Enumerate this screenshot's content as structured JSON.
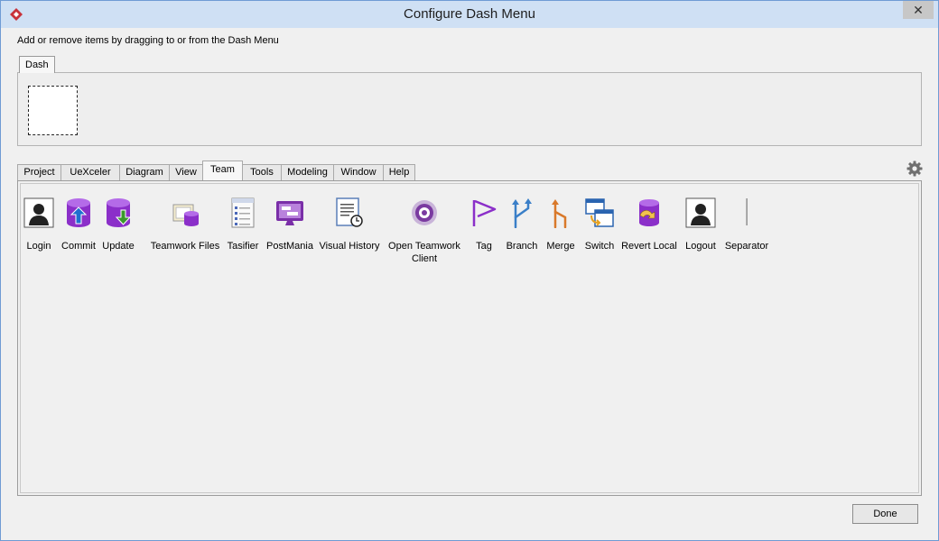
{
  "window": {
    "title": "Configure Dash Menu",
    "close_symbol": "✕"
  },
  "instruction": "Add or remove items by dragging to or from the Dash Menu",
  "dash_tab": "Dash",
  "tabs": [
    {
      "label": "Project"
    },
    {
      "label": "UeXceler"
    },
    {
      "label": "Diagram"
    },
    {
      "label": "View"
    },
    {
      "label": "Team",
      "active": true
    },
    {
      "label": "Tools"
    },
    {
      "label": "Modeling"
    },
    {
      "label": "Window"
    },
    {
      "label": "Help"
    }
  ],
  "items": [
    {
      "label": "Login",
      "icon": "user-silhouette-icon"
    },
    {
      "label": "Commit",
      "icon": "database-commit-icon"
    },
    {
      "label": "Update",
      "icon": "database-update-icon"
    },
    {
      "label": "Teamwork Files",
      "icon": "teamwork-files-icon"
    },
    {
      "label": "Tasifier",
      "icon": "task-list-icon"
    },
    {
      "label": "PostMania",
      "icon": "post-monitor-icon"
    },
    {
      "label": "Visual History",
      "icon": "document-clock-icon"
    },
    {
      "label": "Open Teamwork Client",
      "icon": "teamwork-client-icon"
    },
    {
      "label": "Tag",
      "icon": "flag-icon"
    },
    {
      "label": "Branch",
      "icon": "branch-icon"
    },
    {
      "label": "Merge",
      "icon": "merge-icon"
    },
    {
      "label": "Switch",
      "icon": "switch-window-icon"
    },
    {
      "label": "Revert Local",
      "icon": "database-revert-icon"
    },
    {
      "label": "Logout",
      "icon": "user-silhouette-icon"
    },
    {
      "label": "Separator",
      "icon": "separator-line-icon"
    }
  ],
  "done_button": "Done",
  "colors": {
    "purple": "#8b2fc9",
    "blue_arrow": "#1e6fd0",
    "green_arrow": "#3a9a2a",
    "orange": "#d9792a"
  }
}
